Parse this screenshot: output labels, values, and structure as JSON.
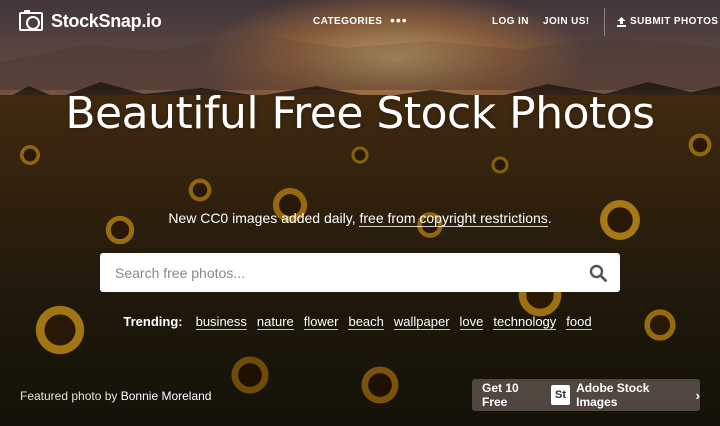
{
  "navbar": {
    "brand": "StockSnap.io",
    "categories": "CATEGORIES",
    "more": "•••",
    "login": "LOG IN",
    "join": "JOIN US!",
    "submit": "SUBMIT PHOTOS"
  },
  "hero": {
    "headline": "Beautiful Free Stock Photos",
    "subhead_prefix": "New CC0 images added daily, ",
    "subhead_link": "free from copyright restrictions",
    "subhead_suffix": "."
  },
  "search": {
    "placeholder": "Search free photos..."
  },
  "trending": {
    "label": "Trending:",
    "tags": [
      "business",
      "nature",
      "flower",
      "beach",
      "wallpaper",
      "love",
      "technology",
      "food"
    ]
  },
  "footer": {
    "credit_prefix": "Featured photo by",
    "credit_author": "Bonnie Moreland",
    "adobe_prefix": "Get 10 Free",
    "adobe_logo": "St",
    "adobe_suffix": "Adobe Stock Images",
    "adobe_chevron": "›"
  },
  "icons": {
    "brand": "camera-icon",
    "submit": "upload-icon",
    "search": "search-icon",
    "adobe": "chevron-right-icon"
  },
  "colors": {
    "search_bg": "#ffffff",
    "text": "#ffffff",
    "adobe_button_bg": "#5a504b"
  }
}
